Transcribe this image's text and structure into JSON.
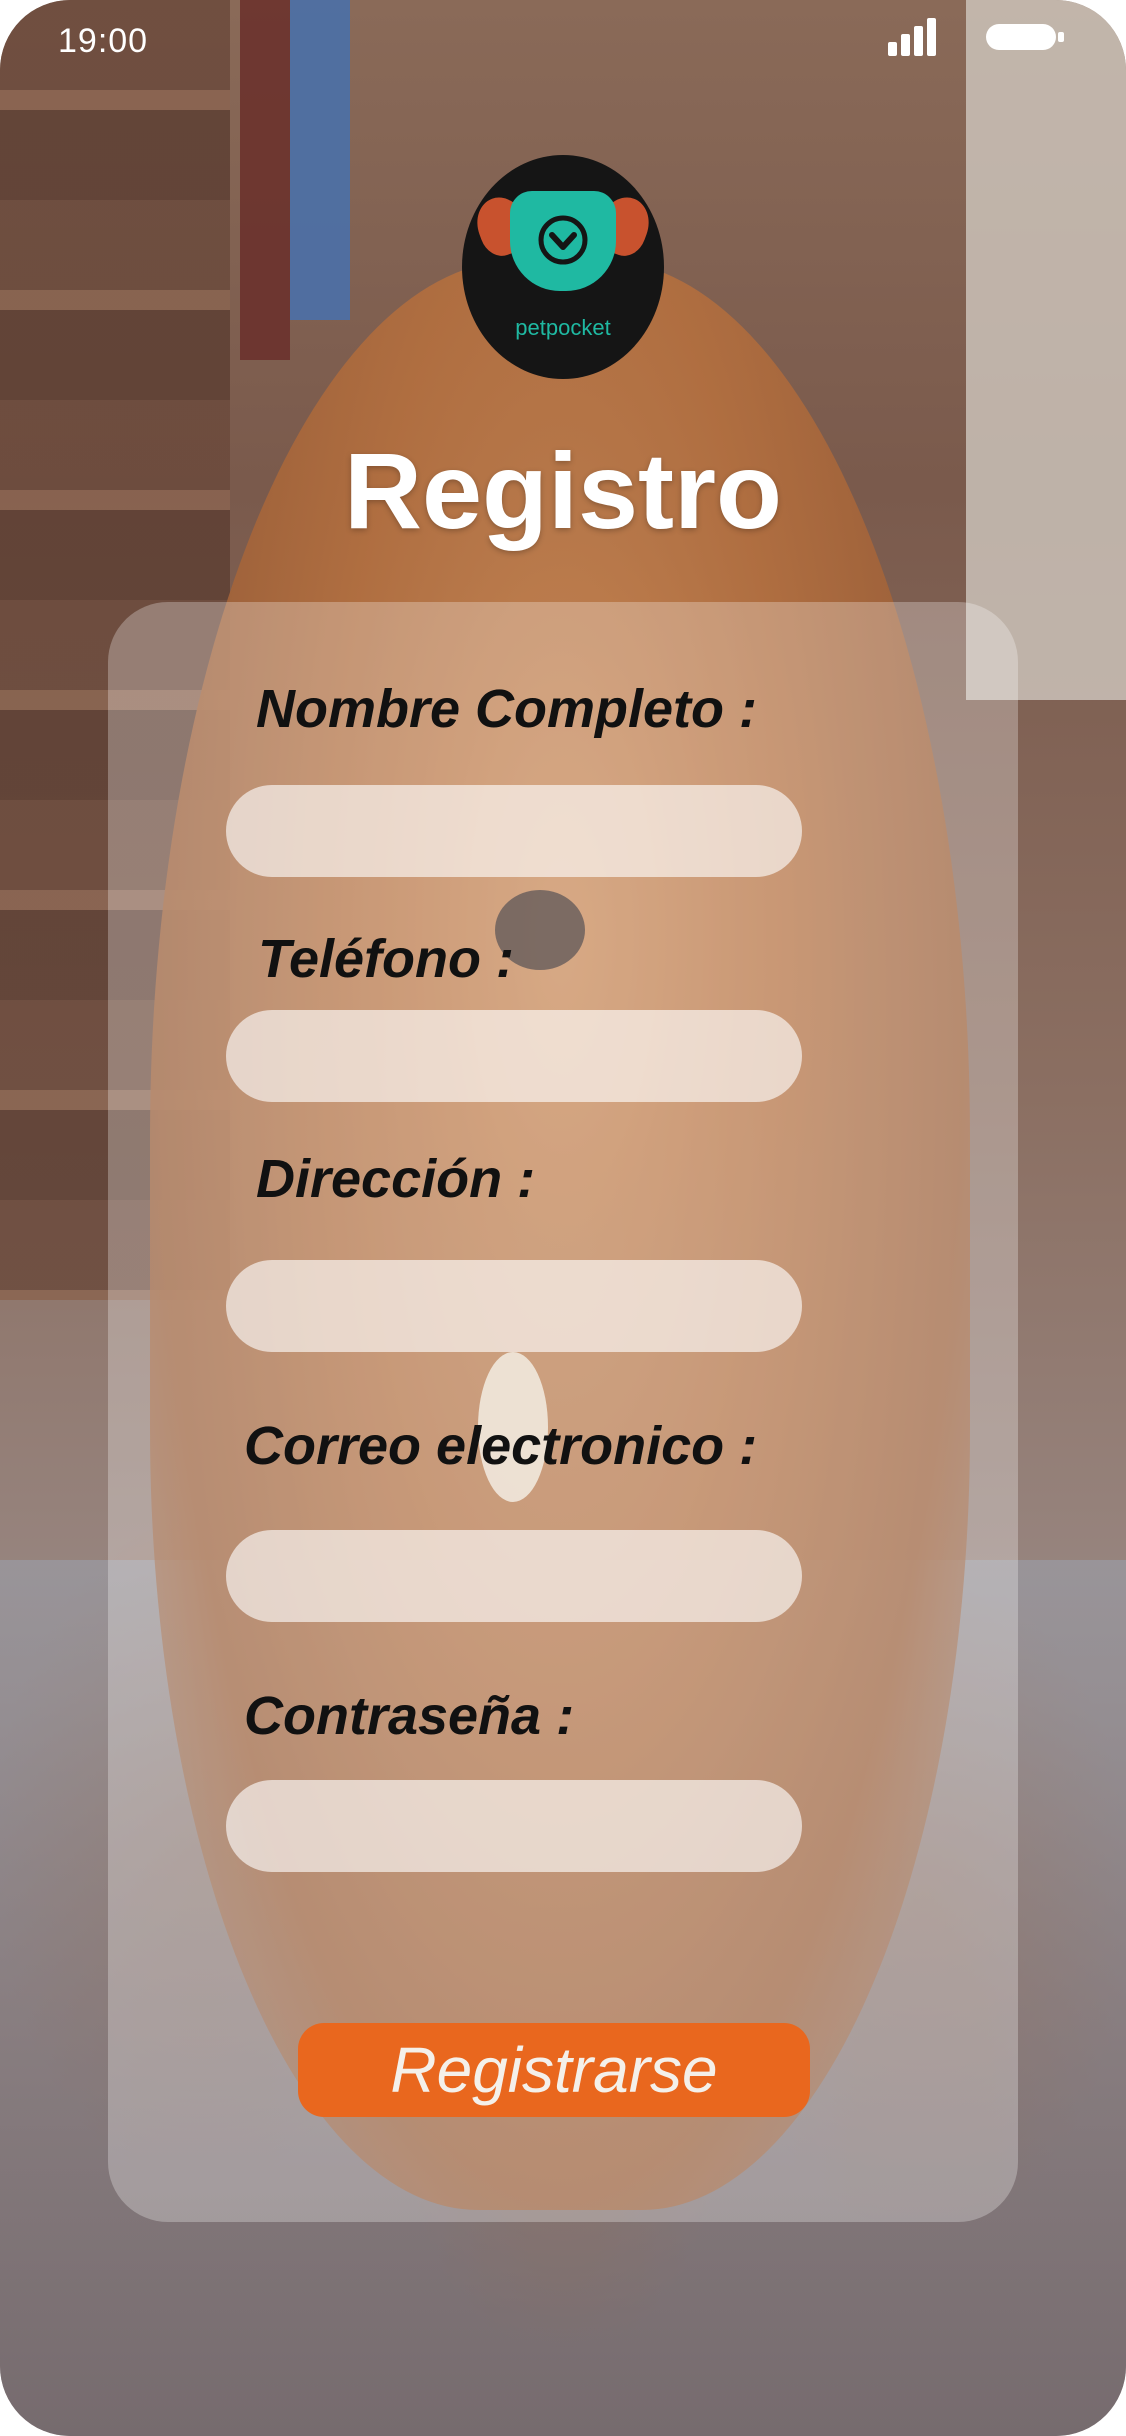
{
  "status_bar": {
    "time": "19:00"
  },
  "logo": {
    "text": "petpocket",
    "icon": "dog-chevron-logo"
  },
  "title": "Registro",
  "form": {
    "fields": [
      {
        "label": "Nombre Completo :",
        "value": "",
        "placeholder": ""
      },
      {
        "label": "Teléfono :",
        "value": "",
        "placeholder": ""
      },
      {
        "label": "Dirección :",
        "value": "",
        "placeholder": ""
      },
      {
        "label": "Correo electronico :",
        "value": "",
        "placeholder": ""
      },
      {
        "label": "Contraseña :",
        "value": "",
        "placeholder": ""
      }
    ],
    "submit_label": "Registrarse"
  },
  "colors": {
    "accent_button": "#e9671e",
    "logo_teal": "#1fb9a2",
    "logo_ear": "#c8522e"
  }
}
